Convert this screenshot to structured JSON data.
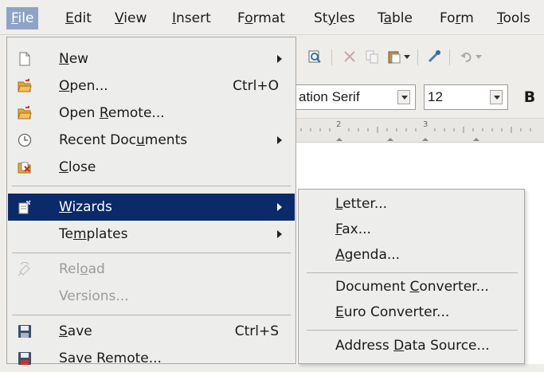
{
  "menubar": {
    "items": [
      {
        "pre": "",
        "u": "F",
        "post": "ile"
      },
      {
        "pre": "",
        "u": "E",
        "post": "dit"
      },
      {
        "pre": "",
        "u": "V",
        "post": "iew"
      },
      {
        "pre": "",
        "u": "I",
        "post": "nsert"
      },
      {
        "pre": "F",
        "u": "o",
        "post": "rmat"
      },
      {
        "pre": "St",
        "u": "y",
        "post": "les"
      },
      {
        "pre": "T",
        "u": "a",
        "post": "ble"
      },
      {
        "pre": "Fo",
        "u": "r",
        "post": "m"
      },
      {
        "pre": "",
        "u": "T",
        "post": "ools"
      }
    ]
  },
  "toolbar": {
    "font_name": "ation Serif",
    "font_size": "12",
    "bold_label": "B"
  },
  "ruler": {
    "marks": [
      "2",
      "3"
    ]
  },
  "file_menu": {
    "items": [
      {
        "pre": "",
        "u": "N",
        "post": "ew",
        "shortcut": "",
        "icon": "new-document-icon"
      },
      {
        "pre": "",
        "u": "O",
        "post": "pen...",
        "shortcut": "Ctrl+O",
        "icon": "open-folder-icon"
      },
      {
        "pre": "Open ",
        "u": "R",
        "post": "emote...",
        "shortcut": "",
        "icon": "open-remote-icon"
      },
      {
        "pre": "Recent Doc",
        "u": "u",
        "post": "ments",
        "shortcut": "",
        "icon": "clock-icon"
      },
      {
        "pre": "",
        "u": "C",
        "post": "lose",
        "shortcut": "",
        "icon": "close-document-icon"
      },
      {
        "pre": "",
        "u": "W",
        "post": "izards",
        "shortcut": "",
        "icon": "wizard-icon"
      },
      {
        "pre": "Te",
        "u": "m",
        "post": "plates",
        "shortcut": "",
        "icon": ""
      },
      {
        "pre": "Rel",
        "u": "o",
        "post": "ad",
        "shortcut": "",
        "icon": "reload-icon"
      },
      {
        "pre": "Versions...",
        "u": "",
        "post": "",
        "shortcut": "",
        "icon": ""
      },
      {
        "pre": "",
        "u": "S",
        "post": "ave",
        "shortcut": "Ctrl+S",
        "icon": "save-icon"
      },
      {
        "pre": "Save Remote...",
        "u": "",
        "post": "",
        "shortcut": "",
        "icon": "save-remote-icon"
      }
    ]
  },
  "wizards_submenu": {
    "items": [
      {
        "pre": "",
        "u": "L",
        "post": "etter..."
      },
      {
        "pre": "",
        "u": "F",
        "post": "ax..."
      },
      {
        "pre": "",
        "u": "A",
        "post": "genda..."
      },
      {
        "pre": "Document ",
        "u": "C",
        "post": "onverter..."
      },
      {
        "pre": "",
        "u": "E",
        "post": "uro Converter..."
      },
      {
        "pre": "Address ",
        "u": "D",
        "post": "ata Source..."
      }
    ]
  },
  "colors": {
    "highlight": "#0a2a6a",
    "menubar_active": "#8fa3c6",
    "disabled_text": "#9d9b98"
  }
}
